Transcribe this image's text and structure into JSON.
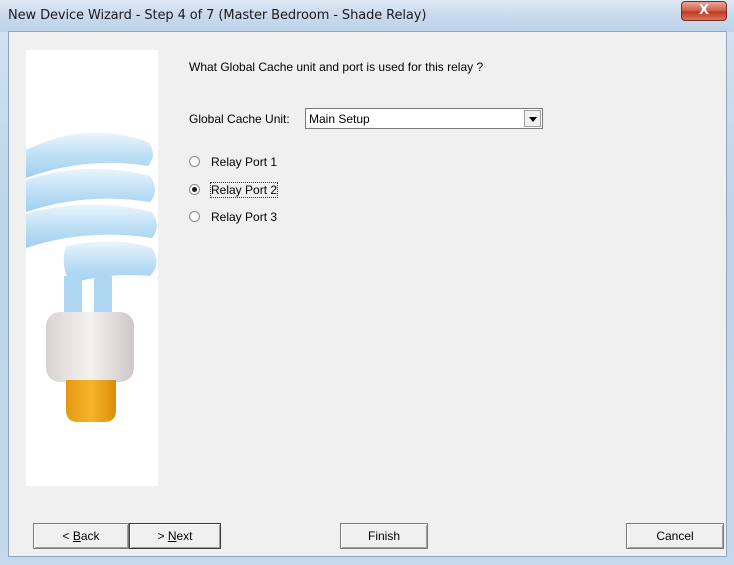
{
  "window": {
    "title": "New Device Wizard - Step 4 of 7 (Master Bedroom - Shade Relay)",
    "close_glyph": "X"
  },
  "wizard": {
    "question": "What Global Cache unit and port is used for this relay ?",
    "unit_label": "Global Cache Unit:",
    "unit_value": "Main Setup",
    "ports": [
      {
        "label": "Relay Port 1",
        "checked": false
      },
      {
        "label": "Relay Port 2",
        "checked": true
      },
      {
        "label": "Relay Port 3",
        "checked": false
      }
    ]
  },
  "buttons": {
    "back": {
      "prefix": "< ",
      "mnemonic": "B",
      "rest": "ack"
    },
    "next": {
      "prefix": "> ",
      "mnemonic": "N",
      "rest": "ext"
    },
    "finish": "Finish",
    "cancel": "Cancel"
  },
  "illustration": {
    "icon": "cfl-bulb-icon",
    "colors": {
      "coil": "#bfe0f5",
      "base": "#ece6e6",
      "tip": "#f0a81c"
    }
  }
}
